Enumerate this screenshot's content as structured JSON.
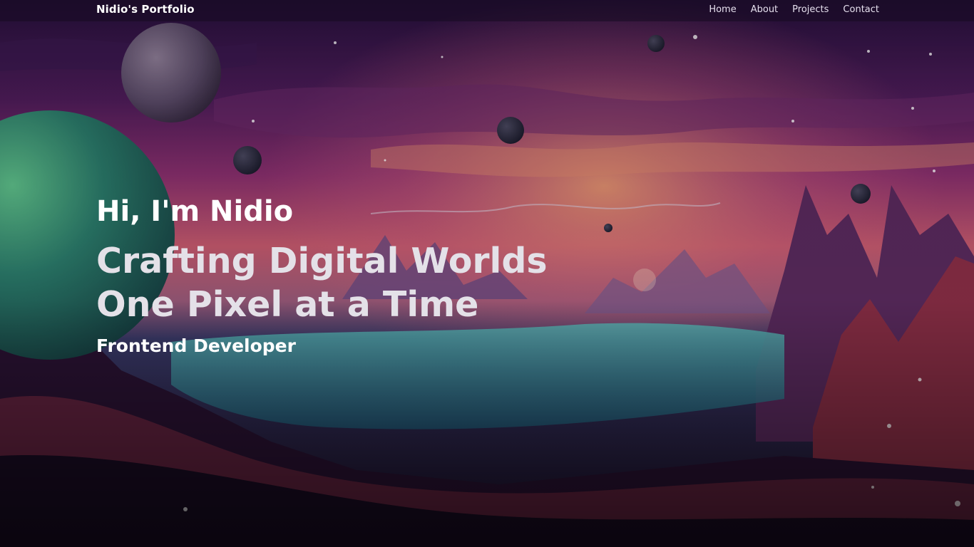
{
  "navbar": {
    "brand": "Nidio's Portfolio",
    "links": [
      {
        "label": "Home"
      },
      {
        "label": "About"
      },
      {
        "label": "Projects"
      },
      {
        "label": "Contact"
      }
    ]
  },
  "hero": {
    "greeting": "Hi, I'm Nidio",
    "title_line1": "Crafting Digital Worlds",
    "title_line2": "One Pixel at a Time",
    "role": "Frontend Developer"
  },
  "colors": {
    "sky_top": "#2a0f3f",
    "sky_mid": "#7a2a6c",
    "horizon_glow": "#e58a6a",
    "water": "#3fa7ad",
    "terrain_dark": "#2a1233",
    "terrain_red": "#a33a4a",
    "planet_green": "#2e8a6a",
    "planet_grey": "#6a5a78"
  },
  "background": {
    "description_icon": "space-landscape-illustration"
  }
}
